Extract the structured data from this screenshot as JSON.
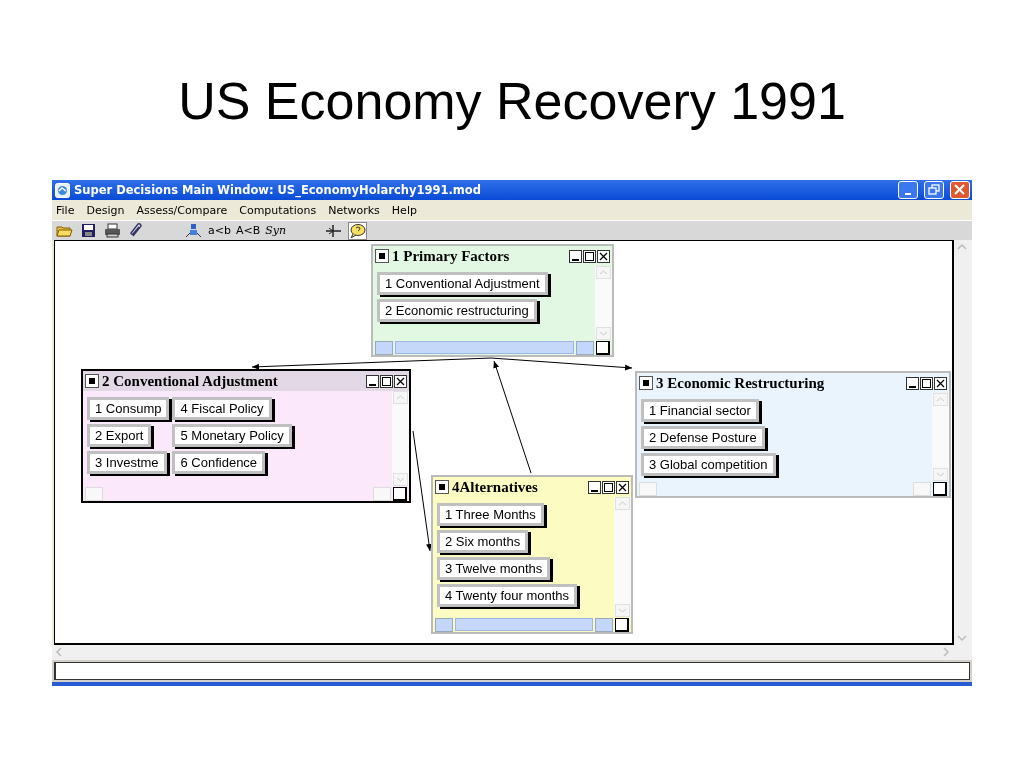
{
  "slide_title": "US Economy Recovery 1991",
  "window": {
    "title": "Super Decisions Main Window: US_EconomyHolarchy1991.mod"
  },
  "menu": [
    {
      "label": "File"
    },
    {
      "label": "Design"
    },
    {
      "label": "Assess/Compare"
    },
    {
      "label": "Computations"
    },
    {
      "label": "Networks"
    },
    {
      "label": "Help"
    }
  ],
  "toolbar": [
    {
      "kind": "open"
    },
    {
      "kind": "save"
    },
    {
      "kind": "print"
    },
    {
      "kind": "attach"
    },
    {
      "kind": "gap"
    },
    {
      "kind": "hierarchy"
    },
    {
      "kind": "text",
      "label": "a<b"
    },
    {
      "kind": "text",
      "label": "A<B"
    },
    {
      "kind": "script",
      "label": "Syn"
    },
    {
      "kind": "gap"
    },
    {
      "kind": "move"
    },
    {
      "kind": "help",
      "selected": true
    }
  ],
  "clusters": [
    {
      "title": "1 Primary Factors",
      "color": "#e2f8e2",
      "selected": false,
      "active": true,
      "nodes": [
        {
          "label": "1 Conventional Adjustment"
        },
        {
          "label": "2 Economic restructuring"
        }
      ]
    },
    {
      "title": "2 Conventional Adjustment",
      "color": "#fbe9fb",
      "selected": true,
      "active": false,
      "nodes": [
        {
          "label": "1 Consump"
        },
        {
          "label": "2 Export"
        },
        {
          "label": "3 Investme"
        },
        {
          "label": "4 Fiscal Policy"
        },
        {
          "label": "5 Monetary Policy"
        },
        {
          "label": "6 Confidence"
        }
      ]
    },
    {
      "title": "3 Economic Restructuring",
      "color": "#e9f4fc",
      "selected": false,
      "active": false,
      "nodes": [
        {
          "label": "1 Financial sector"
        },
        {
          "label": "2 Defense Posture"
        },
        {
          "label": "3 Global competition"
        }
      ]
    },
    {
      "title": "4Alternatives",
      "color": "#fbfbc2",
      "selected": false,
      "active": true,
      "nodes": [
        {
          "label": "1 Three Months"
        },
        {
          "label": "2 Six months"
        },
        {
          "label": "3 Twelve months"
        },
        {
          "label": "4 Twenty four months"
        }
      ]
    }
  ]
}
